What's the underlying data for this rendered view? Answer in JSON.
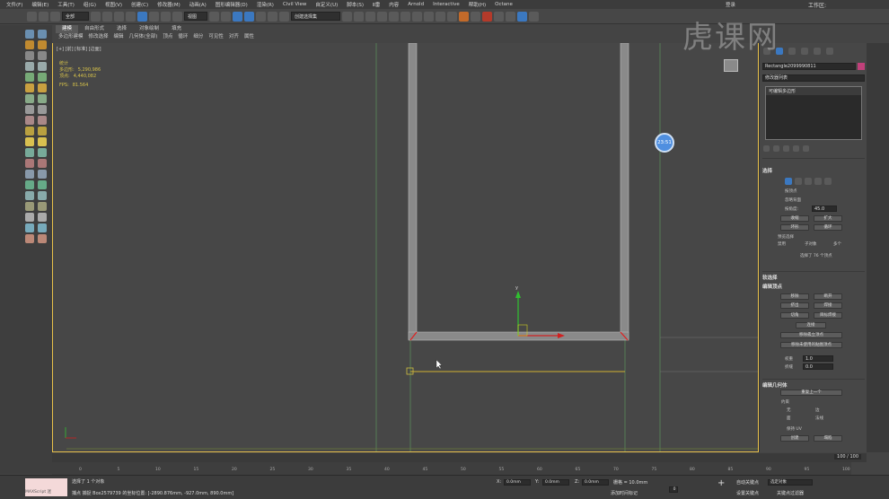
{
  "menu": [
    "文件(F)",
    "编辑(E)",
    "工具(T)",
    "组(G)",
    "视图(V)",
    "创建(C)",
    "修改器(M)",
    "动画(A)",
    "图形编辑器(D)",
    "渲染(R)",
    "Civil View",
    "自定义(U)",
    "脚本(S)",
    "Ⅱ雷",
    "内容",
    "Arnold",
    "Interactive",
    "帮助(H)",
    "Octane"
  ],
  "signin": "登录",
  "workspace_label": "工作区:",
  "toolbar": {
    "filter_select": "全部",
    "view_select": "视图",
    "selection_set": "创建选择集"
  },
  "ribbon": {
    "tabs": [
      "建模",
      "自由形式",
      "选择",
      "对象绘制",
      "填充"
    ],
    "subtabs": [
      "多边形建模",
      "修改选择",
      "编辑",
      "几何体(全部)",
      "顶点",
      "循环",
      "细分",
      "可见性",
      "对齐",
      "属性"
    ]
  },
  "viewport": {
    "label": "[+] [前] [标准] [边面]",
    "stats_title": "统计",
    "stats": [
      {
        "label": "多边形:",
        "value": "5,290,986"
      },
      {
        "label": "顶点:",
        "value": "4,440,082"
      }
    ],
    "fps_label": "FPS:",
    "fps_value": "81.564",
    "axis_y": "y",
    "timer": "23:51"
  },
  "watermark": "虎课网",
  "panel": {
    "object_name": "Rectangle2099990811",
    "modifier_list": "修改器列表",
    "stack_item": "可编辑多边形",
    "selection_header": "选择",
    "by_vertex": "按顶点",
    "ignore_backfacing": "忽略背面",
    "by_angle": "按角度:",
    "angle_value": "45.0",
    "shrink": "收缩",
    "grow": "扩大",
    "ring": "环形",
    "loop": "循环",
    "preview_selection": "预览选择",
    "preview_options": [
      "禁用",
      "子对象",
      "多个"
    ],
    "selected_info": "选择了 76 个顶点",
    "soft_selection": "软选择",
    "edit_vertices": "编辑顶点",
    "remove": "移除",
    "break": "断开",
    "extrude": "挤出",
    "weld": "焊接",
    "chamfer": "切角",
    "target_weld": "目标焊接",
    "connect": "连接",
    "remove_isolated": "移除孤立顶点",
    "remove_unused_map": "移除未使用的贴图顶点",
    "weight_label": "权重",
    "weight_value": "1.0",
    "crease_label": "折缝",
    "crease_value": "0.0",
    "edit_geometry": "编辑几何体",
    "repeat_last": "重复上一个",
    "constraints": "约束",
    "constraint_options": [
      "无",
      "边",
      "面",
      "法线"
    ],
    "preserve_uv": "保持 UV",
    "create": "创建",
    "collapse": "塌陷"
  },
  "timeline": {
    "frame_counter": "100 / 100",
    "ticks": [
      "0",
      "5",
      "10",
      "15",
      "20",
      "25",
      "30",
      "35",
      "40",
      "45",
      "50",
      "55",
      "60",
      "65",
      "70",
      "75",
      "80",
      "85",
      "90",
      "95",
      "100"
    ]
  },
  "status": {
    "maxscript": "MAXScript 迷",
    "selected": "选择了 1 个对象",
    "prompt": "捕点 捕捉 Box2579739 的坐标位置: [-2890.876mm, -927.0mm, 890.0mm]",
    "x_label": "X:",
    "x_value": "0.0mm",
    "y_label": "Y:",
    "y_value": "0.0mm",
    "z_label": "Z:",
    "z_value": "0.0mm",
    "grid_label": "栅格 = 10.0mm",
    "add_time_tag": "添加时间标记",
    "auto_key": "自动关键点",
    "set_key": "设置关键点",
    "selected_object": "选定对象",
    "key_filters": "关键点过滤器",
    "frame": "0",
    "time_config": "100"
  }
}
